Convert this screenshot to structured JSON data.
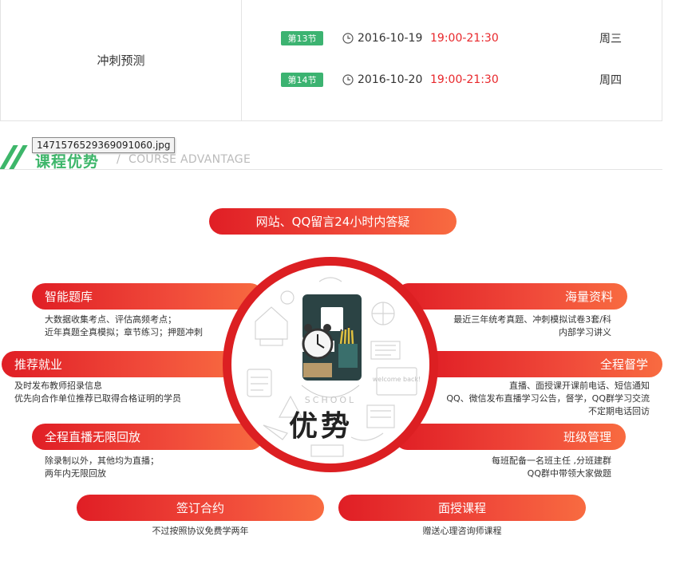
{
  "schedule": {
    "stage": "冲刺预测",
    "rows": [
      {
        "badge": "第13节",
        "date": "2016-10-19",
        "time": "19:00-21:30",
        "weekday": "周三"
      },
      {
        "badge": "第14节",
        "date": "2016-10-20",
        "time": "19:00-21:30",
        "weekday": "周四"
      }
    ]
  },
  "section": {
    "title": "课程优势",
    "separator": "/",
    "subtitle": "COURSE ADVANTAGE",
    "tooltip": "1471576529369091060.jpg"
  },
  "center": {
    "big_text": "优势",
    "school_text": "SCHOOL",
    "board_text": "welcome back!",
    "digit": "9"
  },
  "top_pill": "网站、QQ留言24小时内答疑",
  "left_items": [
    {
      "title": "智能题库",
      "lines": [
        "大数据收集考点、评估高频考点；",
        "近年真题全真模拟；章节练习；押题冲刺"
      ]
    },
    {
      "title": "推荐就业",
      "lines": [
        "及时发布教师招录信息",
        "优先向合作单位推荐已取得合格证明的学员"
      ]
    },
    {
      "title": "全程直播无限回放",
      "lines": [
        "除录制以外，其他均为直播；",
        "两年内无限回放"
      ]
    }
  ],
  "right_items": [
    {
      "title": "海量资料",
      "lines": [
        "最近三年统考真题、冲刺模拟试卷3套/科",
        "内部学习讲义"
      ]
    },
    {
      "title": "全程督学",
      "lines": [
        "直播、面授课开课前电话、短信通知",
        "QQ、微信发布直播学习公告，督学，QQ群学习交流",
        "不定期电话回访"
      ]
    },
    {
      "title": "班级管理",
      "lines": [
        "每班配备一名班主任 ,分班建群",
        "QQ群中带领大家做题"
      ]
    }
  ],
  "bottom_items": [
    {
      "title": "签订合约",
      "line": "不过按照协议免费学两年"
    },
    {
      "title": "面授课程",
      "line": "赠送心理咨询师课程"
    }
  ]
}
